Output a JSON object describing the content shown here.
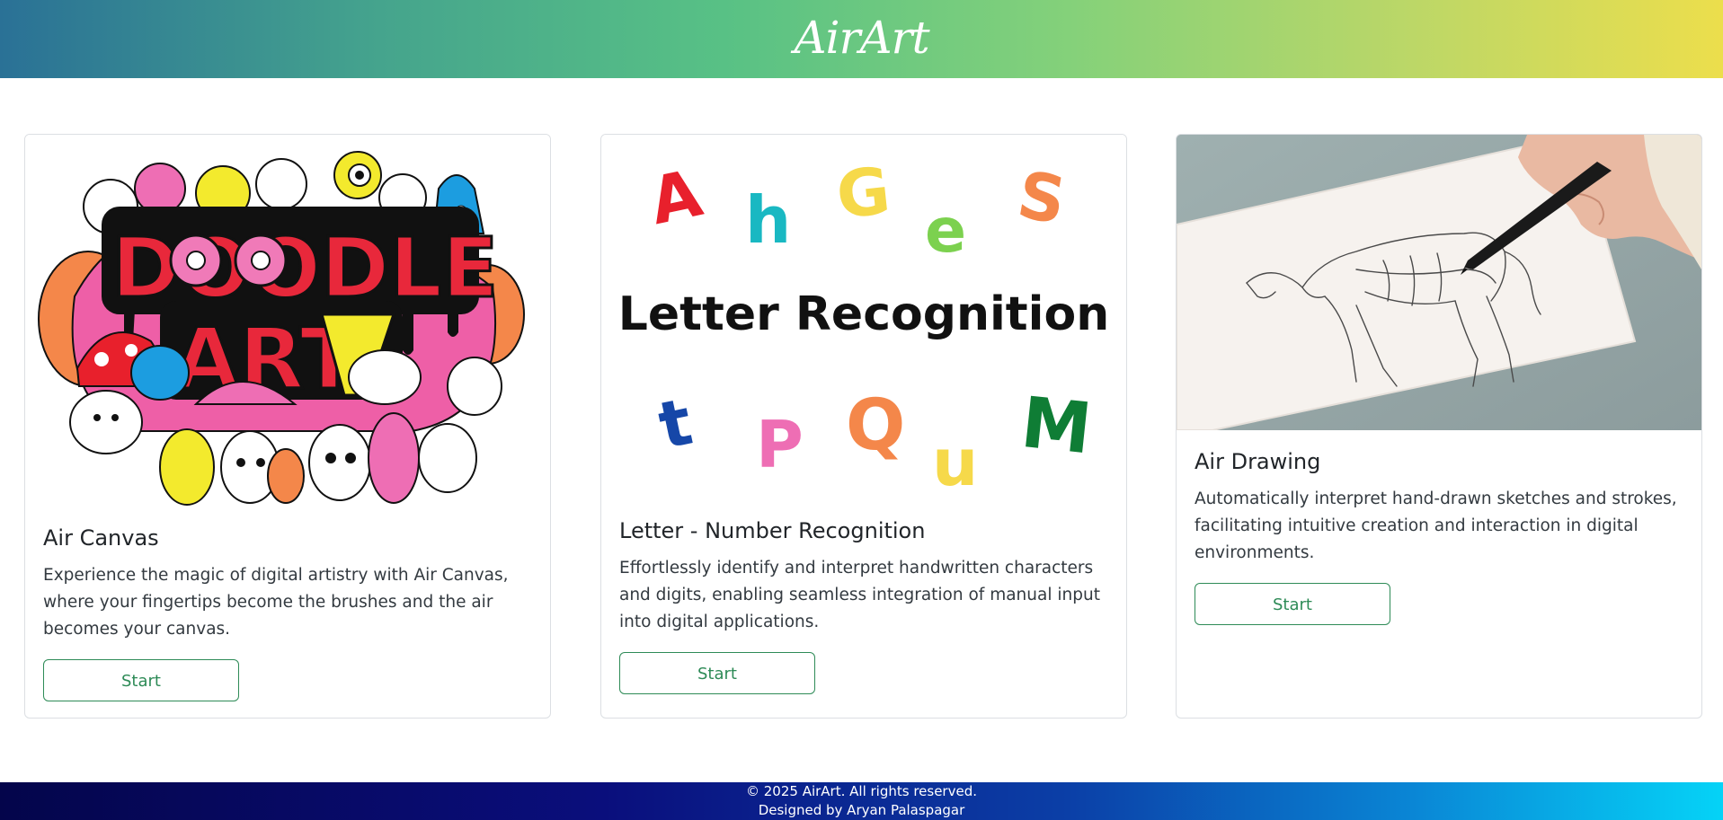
{
  "header": {
    "logo": "AirArt",
    "gradient_start": "#2a7196",
    "gradient_end": "#ecde4c"
  },
  "cards": [
    {
      "title": "Air Canvas",
      "description": "Experience the magic of digital artistry with Air Canvas, where your fingertips become the brushes and the air becomes your canvas.",
      "button_label": "Start",
      "image": {
        "lettering": [
          "DOODLE",
          "ART"
        ]
      }
    },
    {
      "title": "Letter - Number Recognition",
      "description": "Effortlessly identify and interpret handwritten characters and digits, enabling seamless integration of manual input into digital applications.",
      "button_label": "Start",
      "image": {
        "heading": "Letter Recognition",
        "letters": [
          {
            "char": "A",
            "color": "#e8202c"
          },
          {
            "char": "h",
            "color": "#19b8c2"
          },
          {
            "char": "G",
            "color": "#f6d94a"
          },
          {
            "char": "e",
            "color": "#7cd14f"
          },
          {
            "char": "S",
            "color": "#f4874a"
          },
          {
            "char": "t",
            "color": "#1647a8"
          },
          {
            "char": "P",
            "color": "#ee6eb4"
          },
          {
            "char": "Q",
            "color": "#f4874a"
          },
          {
            "char": "u",
            "color": "#f6d94a"
          },
          {
            "char": "M",
            "color": "#0f7d35"
          }
        ]
      }
    },
    {
      "title": "Air Drawing",
      "description": "Automatically interpret hand-drawn sketches and strokes, facilitating intuitive creation and interaction in digital environments.",
      "button_label": "Start",
      "image": {}
    }
  ],
  "footer": {
    "copyright": "© 2025 AirArt. All rights reserved.",
    "credit": "Designed by Aryan Palaspagar"
  },
  "colors": {
    "button_accent": "#2e8b57",
    "footer_start": "#04054b",
    "footer_end": "#05d3f7"
  }
}
